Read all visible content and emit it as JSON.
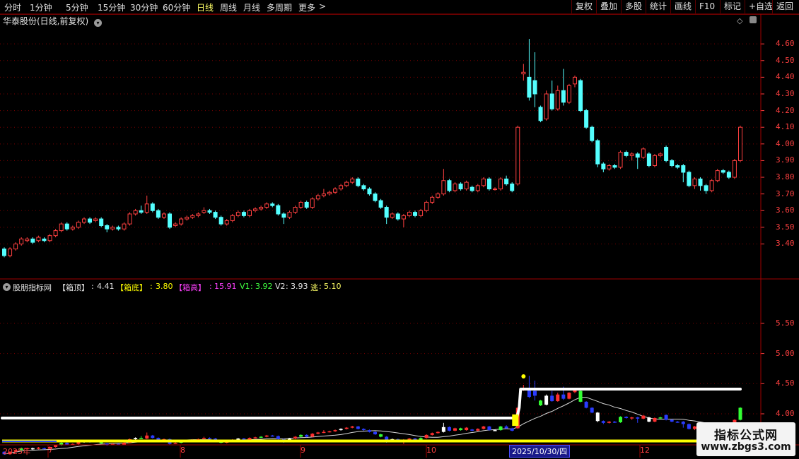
{
  "toolbar": {
    "periods": [
      "分时",
      "1分钟",
      "5分钟",
      "15分钟",
      "30分钟",
      "60分钟",
      "日线",
      "周线",
      "月线",
      "多周期",
      "更多"
    ],
    "active_period": "日线",
    "more_arrow": ">",
    "right_buttons": [
      "复权",
      "叠加",
      "多股",
      "统计",
      "画线",
      "F10",
      "标记",
      "+自选",
      "返回"
    ]
  },
  "main_panel": {
    "title": "华泰股份(日线,前复权)",
    "price_axis": [
      "4.60",
      "4.50",
      "4.40",
      "4.30",
      "4.20",
      "4.10",
      "4.00",
      "3.90",
      "3.80",
      "3.70",
      "3.60",
      "3.50",
      "3.40"
    ]
  },
  "indicator_panel": {
    "name": "股朋指标网",
    "items": [
      {
        "label": "【箱顶】",
        "value": "4.41"
      },
      {
        "label": "【箱底】",
        "value": "3.80"
      },
      {
        "label": "【箱高】",
        "value": "15.91"
      },
      {
        "label": "V1",
        "value": "3.92"
      },
      {
        "label": "V2",
        "value": "3.93"
      },
      {
        "label": "逃",
        "value": "5.10"
      }
    ],
    "axis": [
      "5.50",
      "5.00",
      "4.50",
      "4.00"
    ]
  },
  "date_axis": {
    "year": "2025年",
    "months": [
      "7",
      "8",
      "9",
      "10",
      "12"
    ],
    "cursor_date": "2025/10/30/四"
  },
  "watermark": {
    "title": "指标公式网",
    "url": "www.zbgs3.com"
  },
  "colors": {
    "up": "#ff4040",
    "down": "#54ffff",
    "grid": "#7a0000",
    "box_line": "#ffffff",
    "box_bottom": "#ffff00"
  },
  "chart_data": {
    "type": "candlestick",
    "price_range": [
      3.33,
      4.66
    ],
    "indicator_range": [
      3.52,
      5.85
    ],
    "candles": [
      [
        3.37,
        3.33,
        3.38,
        3.32
      ],
      [
        3.33,
        3.37,
        3.38,
        3.32
      ],
      [
        3.37,
        3.4,
        3.41,
        3.36
      ],
      [
        3.4,
        3.43,
        3.44,
        3.39
      ],
      [
        3.42,
        3.43,
        3.44,
        3.41
      ],
      [
        3.43,
        3.41,
        3.44,
        3.4
      ],
      [
        3.42,
        3.44,
        3.45,
        3.41
      ],
      [
        3.43,
        3.42,
        3.44,
        3.41
      ],
      [
        3.42,
        3.45,
        3.46,
        3.41
      ],
      [
        3.45,
        3.48,
        3.49,
        3.44
      ],
      [
        3.48,
        3.52,
        3.53,
        3.47
      ],
      [
        3.52,
        3.49,
        3.53,
        3.48
      ],
      [
        3.49,
        3.5,
        3.51,
        3.48
      ],
      [
        3.5,
        3.53,
        3.54,
        3.49
      ],
      [
        3.53,
        3.55,
        3.56,
        3.52
      ],
      [
        3.55,
        3.53,
        3.56,
        3.52
      ],
      [
        3.54,
        3.55,
        3.56,
        3.53
      ],
      [
        3.55,
        3.51,
        3.56,
        3.5
      ],
      [
        3.51,
        3.49,
        3.52,
        3.47
      ],
      [
        3.49,
        3.5,
        3.51,
        3.48
      ],
      [
        3.5,
        3.49,
        3.51,
        3.48
      ],
      [
        3.49,
        3.52,
        3.53,
        3.48
      ],
      [
        3.52,
        3.58,
        3.59,
        3.51
      ],
      [
        3.58,
        3.6,
        3.61,
        3.57
      ],
      [
        3.6,
        3.59,
        3.63,
        3.58
      ],
      [
        3.59,
        3.64,
        3.69,
        3.58
      ],
      [
        3.64,
        3.6,
        3.65,
        3.59
      ],
      [
        3.6,
        3.56,
        3.61,
        3.55
      ],
      [
        3.56,
        3.58,
        3.59,
        3.55
      ],
      [
        3.58,
        3.5,
        3.59,
        3.49
      ],
      [
        3.51,
        3.52,
        3.53,
        3.5
      ],
      [
        3.52,
        3.55,
        3.56,
        3.51
      ],
      [
        3.55,
        3.56,
        3.57,
        3.54
      ],
      [
        3.56,
        3.57,
        3.58,
        3.55
      ],
      [
        3.57,
        3.58,
        3.59,
        3.56
      ],
      [
        3.59,
        3.6,
        3.62,
        3.58
      ],
      [
        3.6,
        3.59,
        3.61,
        3.58
      ],
      [
        3.59,
        3.56,
        3.6,
        3.55
      ],
      [
        3.56,
        3.52,
        3.57,
        3.51
      ],
      [
        3.52,
        3.54,
        3.55,
        3.51
      ],
      [
        3.54,
        3.57,
        3.58,
        3.53
      ],
      [
        3.57,
        3.59,
        3.6,
        3.56
      ],
      [
        3.59,
        3.57,
        3.6,
        3.56
      ],
      [
        3.57,
        3.6,
        3.61,
        3.56
      ],
      [
        3.6,
        3.61,
        3.62,
        3.59
      ],
      [
        3.61,
        3.62,
        3.63,
        3.6
      ],
      [
        3.62,
        3.64,
        3.65,
        3.61
      ],
      [
        3.64,
        3.63,
        3.65,
        3.62
      ],
      [
        3.63,
        3.58,
        3.64,
        3.57
      ],
      [
        3.58,
        3.56,
        3.59,
        3.52
      ],
      [
        3.56,
        3.59,
        3.6,
        3.55
      ],
      [
        3.59,
        3.62,
        3.63,
        3.58
      ],
      [
        3.62,
        3.65,
        3.66,
        3.61
      ],
      [
        3.65,
        3.62,
        3.66,
        3.61
      ],
      [
        3.62,
        3.67,
        3.68,
        3.61
      ],
      [
        3.67,
        3.69,
        3.7,
        3.66
      ],
      [
        3.69,
        3.7,
        3.73,
        3.68
      ],
      [
        3.7,
        3.71,
        3.72,
        3.69
      ],
      [
        3.71,
        3.73,
        3.74,
        3.7
      ],
      [
        3.73,
        3.75,
        3.76,
        3.72
      ],
      [
        3.75,
        3.77,
        3.78,
        3.74
      ],
      [
        3.77,
        3.79,
        3.8,
        3.76
      ],
      [
        3.79,
        3.75,
        3.8,
        3.74
      ],
      [
        3.75,
        3.73,
        3.76,
        3.72
      ],
      [
        3.73,
        3.7,
        3.74,
        3.69
      ],
      [
        3.7,
        3.66,
        3.71,
        3.65
      ],
      [
        3.66,
        3.62,
        3.67,
        3.61
      ],
      [
        3.62,
        3.56,
        3.63,
        3.52
      ],
      [
        3.56,
        3.58,
        3.59,
        3.55
      ],
      [
        3.58,
        3.55,
        3.59,
        3.54
      ],
      [
        3.55,
        3.57,
        3.58,
        3.5
      ],
      [
        3.57,
        3.59,
        3.6,
        3.56
      ],
      [
        3.59,
        3.57,
        3.6,
        3.56
      ],
      [
        3.57,
        3.6,
        3.61,
        3.56
      ],
      [
        3.6,
        3.65,
        3.66,
        3.59
      ],
      [
        3.65,
        3.68,
        3.69,
        3.64
      ],
      [
        3.68,
        3.7,
        3.71,
        3.67
      ],
      [
        3.7,
        3.78,
        3.85,
        3.69
      ],
      [
        3.78,
        3.72,
        3.79,
        3.71
      ],
      [
        3.72,
        3.76,
        3.77,
        3.71
      ],
      [
        3.76,
        3.73,
        3.77,
        3.72
      ],
      [
        3.73,
        3.77,
        3.78,
        3.72
      ],
      [
        3.74,
        3.72,
        3.75,
        3.71
      ],
      [
        3.72,
        3.75,
        3.76,
        3.71
      ],
      [
        3.75,
        3.79,
        3.8,
        3.74
      ],
      [
        3.79,
        3.73,
        3.8,
        3.72
      ],
      [
        3.73,
        3.73,
        3.74,
        3.72
      ],
      [
        3.73,
        3.79,
        3.8,
        3.72
      ],
      [
        3.79,
        3.76,
        3.81,
        3.75
      ],
      [
        3.76,
        3.72,
        3.77,
        3.71
      ],
      [
        3.76,
        4.1,
        4.11,
        3.75
      ],
      [
        4.42,
        4.43,
        4.48,
        4.38
      ],
      [
        4.4,
        4.28,
        4.63,
        4.26
      ],
      [
        4.38,
        4.3,
        4.55,
        4.22
      ],
      [
        4.22,
        4.14,
        4.23,
        4.13
      ],
      [
        4.15,
        4.3,
        4.32,
        4.14
      ],
      [
        4.3,
        4.21,
        4.38,
        4.2
      ],
      [
        4.21,
        4.32,
        4.35,
        4.2
      ],
      [
        4.32,
        4.25,
        4.45,
        4.23
      ],
      [
        4.25,
        4.35,
        4.36,
        4.24
      ],
      [
        4.36,
        4.4,
        4.41,
        4.34
      ],
      [
        4.38,
        4.2,
        4.39,
        4.19
      ],
      [
        4.2,
        4.1,
        4.21,
        4.09
      ],
      [
        4.1,
        4.02,
        4.11,
        4.01
      ],
      [
        4.02,
        3.88,
        4.03,
        3.86
      ],
      [
        3.88,
        3.85,
        3.89,
        3.83
      ],
      [
        3.85,
        3.87,
        3.88,
        3.84
      ],
      [
        3.87,
        3.86,
        3.88,
        3.85
      ],
      [
        3.86,
        3.95,
        3.96,
        3.85
      ],
      [
        3.95,
        3.93,
        3.96,
        3.92
      ],
      [
        3.93,
        3.94,
        3.95,
        3.9
      ],
      [
        3.94,
        3.92,
        3.95,
        3.85
      ],
      [
        3.92,
        3.97,
        3.98,
        3.91
      ],
      [
        3.94,
        3.87,
        3.95,
        3.86
      ],
      [
        3.87,
        3.93,
        3.94,
        3.86
      ],
      [
        3.93,
        3.94,
        3.95,
        3.92
      ],
      [
        3.98,
        3.9,
        3.99,
        3.89
      ],
      [
        3.9,
        3.87,
        3.91,
        3.86
      ],
      [
        3.87,
        3.86,
        3.88,
        3.85
      ],
      [
        3.87,
        3.83,
        3.88,
        3.77
      ],
      [
        3.83,
        3.75,
        3.84,
        3.74
      ],
      [
        3.75,
        3.79,
        3.8,
        3.73
      ],
      [
        3.79,
        3.75,
        3.8,
        3.72
      ],
      [
        3.75,
        3.72,
        3.76,
        3.7
      ],
      [
        3.72,
        3.78,
        3.79,
        3.71
      ],
      [
        3.78,
        3.84,
        3.85,
        3.77
      ],
      [
        3.84,
        3.83,
        3.85,
        3.82
      ],
      [
        3.83,
        3.8,
        3.84,
        3.79
      ],
      [
        3.8,
        3.9,
        3.91,
        3.79
      ],
      [
        3.9,
        4.1,
        4.11,
        3.89
      ]
    ]
  }
}
